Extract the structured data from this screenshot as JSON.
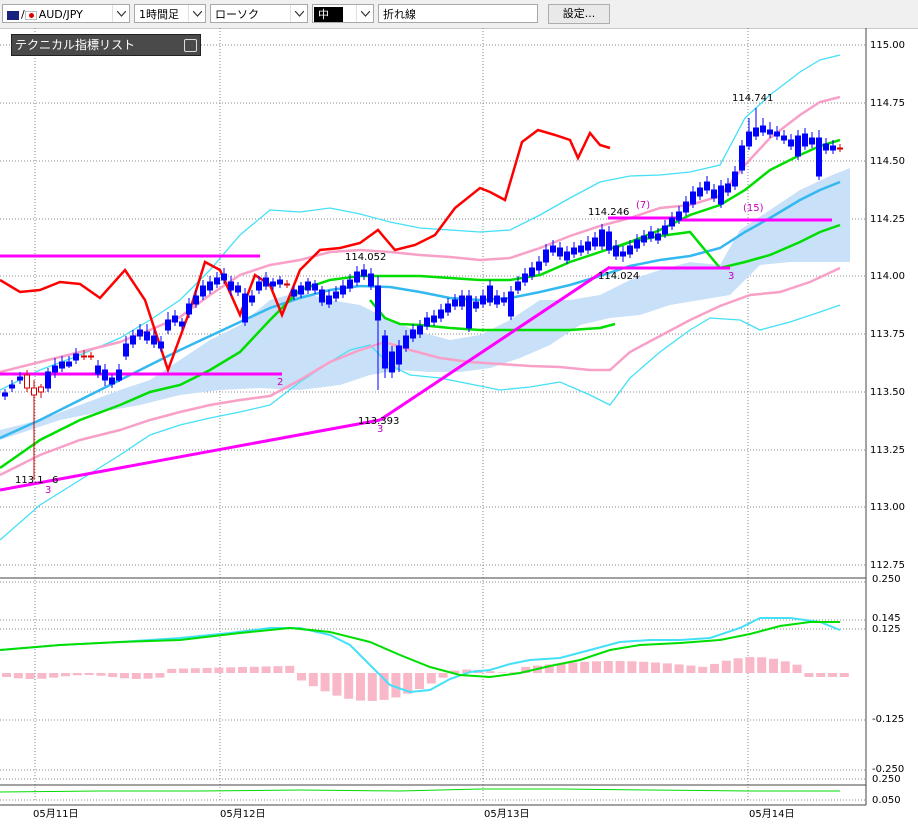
{
  "toolbar": {
    "symbol": "AUD/JPY",
    "timeframe": "1時間足",
    "chart_type": "ローソク",
    "line_width": "中",
    "line_color": "#000000",
    "line_style": "折れ線",
    "settings_label": "設定..."
  },
  "indicator_panel": {
    "title": "テクニカル指標リスト"
  },
  "price_axis": [
    "115.00",
    "114.75",
    "114.50",
    "114.25",
    "114.00",
    "113.75",
    "113.50",
    "113.25",
    "113.00",
    "112.75"
  ],
  "osc_axis": [
    "0.250",
    "0.145",
    "0.125",
    "-0.125",
    "-0.250",
    "0.250",
    "0.050"
  ],
  "date_axis": [
    "05月11日",
    "05月12日",
    "05月13日",
    "05月14日"
  ],
  "annotations": {
    "high_1": "114.052",
    "low_1": "113.393",
    "low_0": "113.1",
    "low_0b": "6",
    "high_2": "114.246",
    "low_2": "114.024",
    "high_3": "114.741",
    "count_7": "(7)",
    "count_15": "(15)",
    "mark_2": "2",
    "mark_3a": "3",
    "mark_3b": "3",
    "mark_3c": "3"
  },
  "colors": {
    "bull_candle": "#d40000",
    "bear_candle": "#0000ff",
    "magenta": "#ff00ff",
    "red_line": "#ff0000",
    "green": "#00dd00",
    "sky": "#33b8f0",
    "cyan": "#44e0f8",
    "pink": "#f8a0c8",
    "cloud": "#c8e0f8"
  }
}
